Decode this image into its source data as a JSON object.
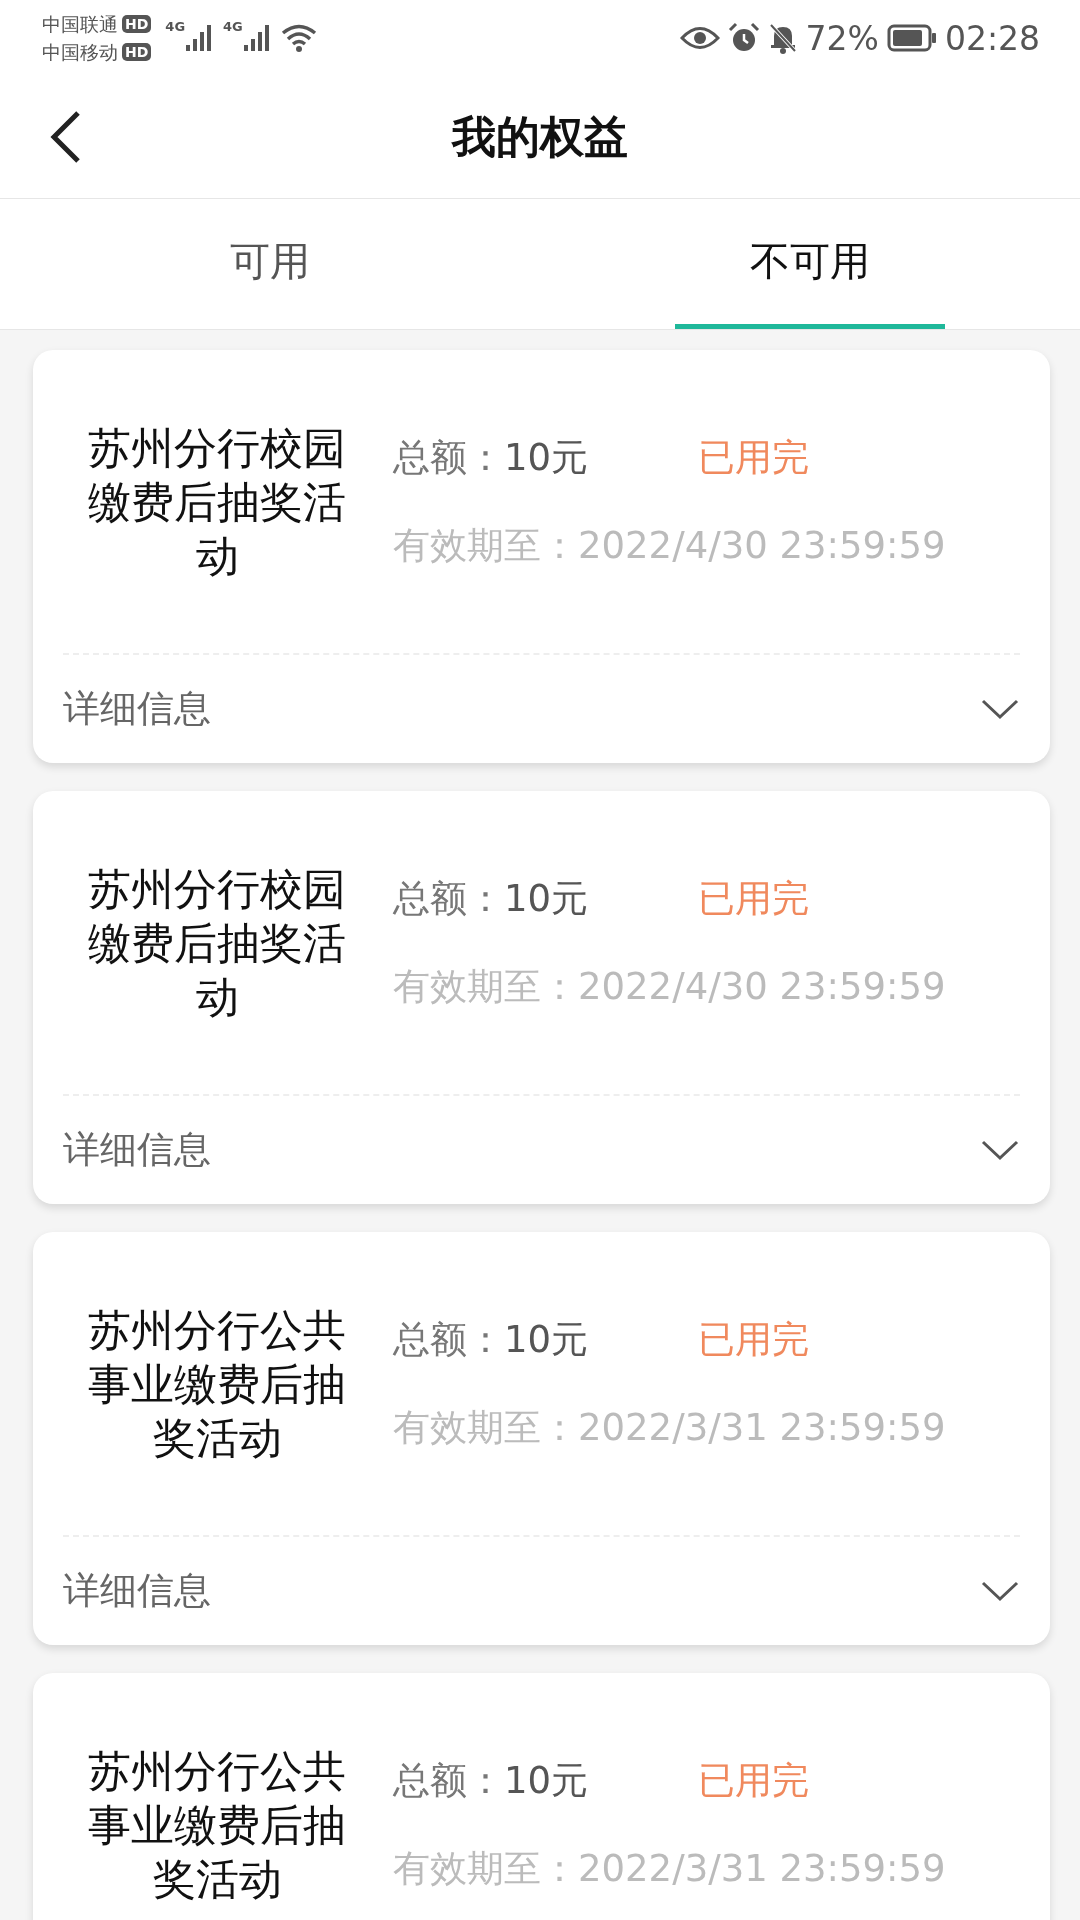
{
  "status_bar": {
    "carriers": [
      {
        "name": "中国联通",
        "badge": "HD"
      },
      {
        "name": "中国移动",
        "badge": "HD"
      }
    ],
    "network_labels": [
      "4G",
      "4G"
    ],
    "battery_percent": "72%",
    "time": "02:28"
  },
  "header": {
    "title": "我的权益"
  },
  "tabs": [
    {
      "label": "可用",
      "selected": false
    },
    {
      "label": "不可用",
      "selected": true
    }
  ],
  "cards": [
    {
      "title": "苏州分行校园缴费后抽奖活动",
      "amount_label": "总额：",
      "amount": "10元",
      "status": "已用完",
      "validity_label": "有效期至：",
      "validity": "2022/4/30 23:59:59",
      "details_label": "详细信息",
      "expanded": false
    },
    {
      "title": "苏州分行校园缴费后抽奖活动",
      "amount_label": "总额：",
      "amount": "10元",
      "status": "已用完",
      "validity_label": "有效期至：",
      "validity": "2022/4/30 23:59:59",
      "details_label": "详细信息",
      "expanded": false
    },
    {
      "title": "苏州分行公共事业缴费后抽奖活动",
      "amount_label": "总额：",
      "amount": "10元",
      "status": "已用完",
      "validity_label": "有效期至：",
      "validity": "2022/3/31 23:59:59",
      "details_label": "详细信息",
      "expanded": false
    },
    {
      "title": "苏州分行公共事业缴费后抽奖活动",
      "amount_label": "总额：",
      "amount": "10元",
      "status": "已用完",
      "validity_label": "有效期至：",
      "validity": "2022/3/31 23:59:59"
    }
  ]
}
